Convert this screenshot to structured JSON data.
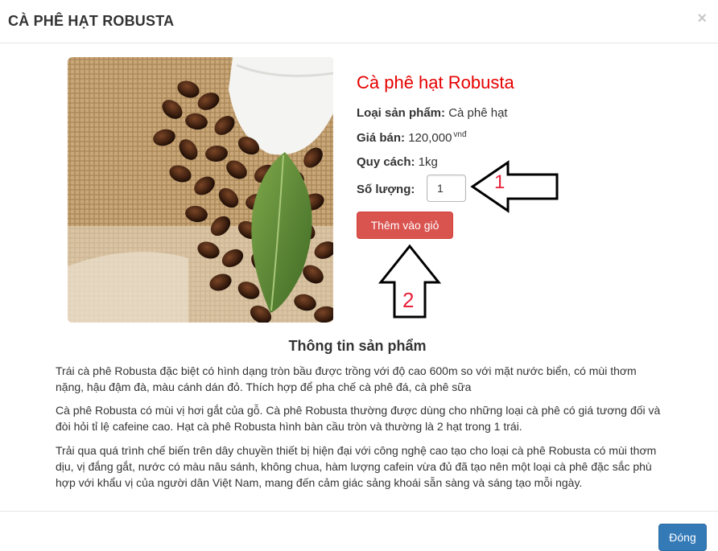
{
  "modal": {
    "title": "CÀ PHÊ HẠT ROBUSTA",
    "close_symbol": "×"
  },
  "product": {
    "name": "Cà phê hạt Robusta",
    "category_label": "Loại sản phẩm:",
    "category_value": "Cà phê hạt",
    "price_label": "Giá bán:",
    "price_value": "120,000",
    "price_unit": "vnđ",
    "spec_label": "Quy cách:",
    "spec_value": "1kg",
    "quantity_label": "Số lượng:",
    "quantity_value": "1",
    "add_to_cart_label": "Thêm vào giỏ"
  },
  "annotations": {
    "arrow_1_number": "1",
    "arrow_2_number": "2",
    "number_color": "#e8213a"
  },
  "description": {
    "title": "Thông tin sản phẩm",
    "paragraphs": [
      "Trái cà phê Robusta đặc biệt có hình dạng tròn bầu được trồng với độ cao 600m so với mặt nước biển, có mùi thơm nặng, hậu đậm đà, màu cánh dán đỏ. Thích hợp để pha chế cà phê đá, cà phê sữa",
      "Cà phê Robusta có mùi vị hơi gắt của gỗ. Cà phê Robusta thường được dùng cho những loại cà phê có giá tương đối và đòi hỏi tỉ lệ cafeine cao. Hạt cà phê Robusta hình bàn cầu tròn và thường là 2 hạt trong 1 trái.",
      "Trải qua quá trình chế biến trên dây chuyền thiết bị hiện đại với công nghệ cao tạo cho loại cà phê Robusta có mùi thơm dịu, vị đắng gắt, nước có màu nâu sánh, không chua, hàm lượng cafein vừa đủ đã tạo nên một loại cà phê đặc sắc phù hợp với khẩu vị của người dân Việt Nam, mang đến cảm giác sảng khoái sẵn sàng và sáng tạo mỗi ngày."
    ]
  },
  "footer": {
    "close_label": "Đóng"
  },
  "colors": {
    "product_name": "#e60000",
    "add_button": "#d9534f",
    "close_button": "#337ab7"
  },
  "icons": {
    "close": "close-x-icon",
    "arrow_left": "arrow-left-icon",
    "arrow_up": "arrow-up-icon"
  }
}
